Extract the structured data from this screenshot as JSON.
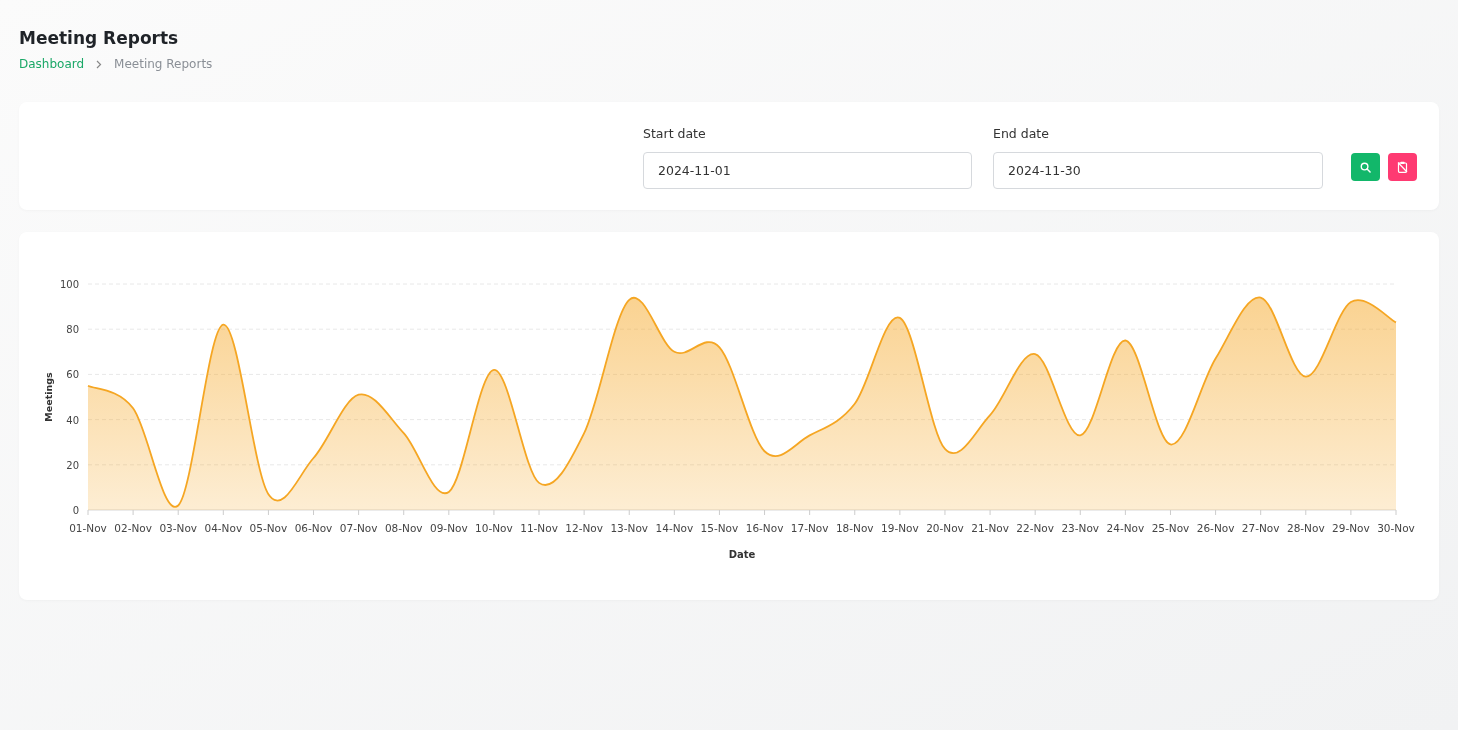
{
  "page": {
    "title": "Meeting Reports"
  },
  "breadcrumb": [
    {
      "label": "Dashboard",
      "kind": "link"
    },
    {
      "label": "Meeting Reports",
      "kind": "current"
    }
  ],
  "filters": {
    "start_date": {
      "label": "Start date",
      "value": "2024-11-01"
    },
    "end_date": {
      "label": "End date",
      "value": "2024-11-30"
    }
  },
  "chart": {
    "chart_data": {
      "type": "area",
      "xlabel": "Date",
      "ylabel": "Meetings",
      "categories": [
        "01-Nov",
        "02-Nov",
        "03-Nov",
        "04-Nov",
        "05-Nov",
        "06-Nov",
        "07-Nov",
        "08-Nov",
        "09-Nov",
        "10-Nov",
        "11-Nov",
        "12-Nov",
        "13-Nov",
        "14-Nov",
        "15-Nov",
        "16-Nov",
        "17-Nov",
        "18-Nov",
        "19-Nov",
        "20-Nov",
        "21-Nov",
        "22-Nov",
        "23-Nov",
        "24-Nov",
        "25-Nov",
        "26-Nov",
        "27-Nov",
        "28-Nov",
        "29-Nov",
        "30-Nov"
      ],
      "series": [
        {
          "color": "#f5a623",
          "values": [
            55,
            45,
            2,
            82,
            7,
            23,
            51,
            34,
            8,
            62,
            12,
            34,
            93,
            70,
            72,
            26,
            33,
            47,
            85,
            27,
            42,
            69,
            33,
            75,
            29,
            67,
            94,
            59,
            92,
            83
          ]
        }
      ],
      "ylim": [
        0,
        100
      ],
      "grid": true,
      "yticks": [
        0,
        20,
        40,
        60,
        80,
        100
      ]
    }
  }
}
